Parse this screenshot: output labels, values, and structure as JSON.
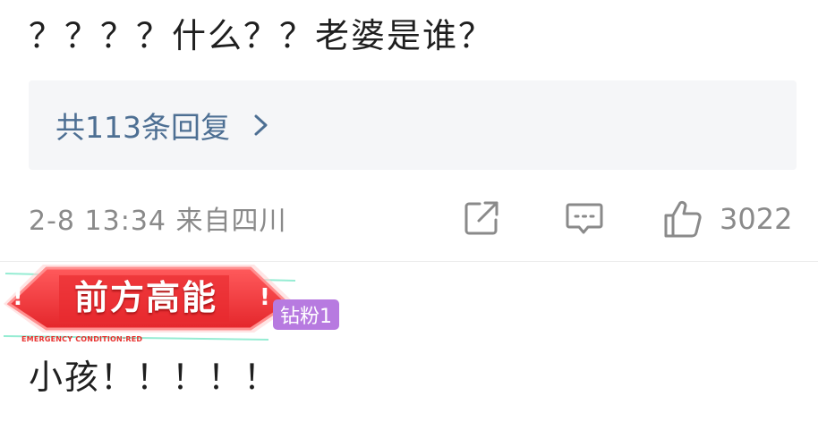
{
  "comment": {
    "text": "？？？？什么？？老婆是谁？"
  },
  "replies": {
    "label": "共113条回复"
  },
  "meta": {
    "date_location": "2-8 13:34 来自四川",
    "like_count": "3022"
  },
  "icons": {
    "chevron": "chevron-right-icon",
    "share": "share-icon",
    "comment": "comment-icon",
    "like": "thumbs-up-icon"
  },
  "next_comment": {
    "banner_title": "前方高能",
    "banner_subtitle": "EMERGENCY CONDITION:RED",
    "fan_badge": "钻粉1",
    "text": "小孩！！！！！"
  },
  "colors": {
    "link": "#4d6f93",
    "meta": "#8a8a8a",
    "replies_bg": "#f5f6f8",
    "banner_red": "#f0363a",
    "badge_purple": "#b77ae0"
  }
}
